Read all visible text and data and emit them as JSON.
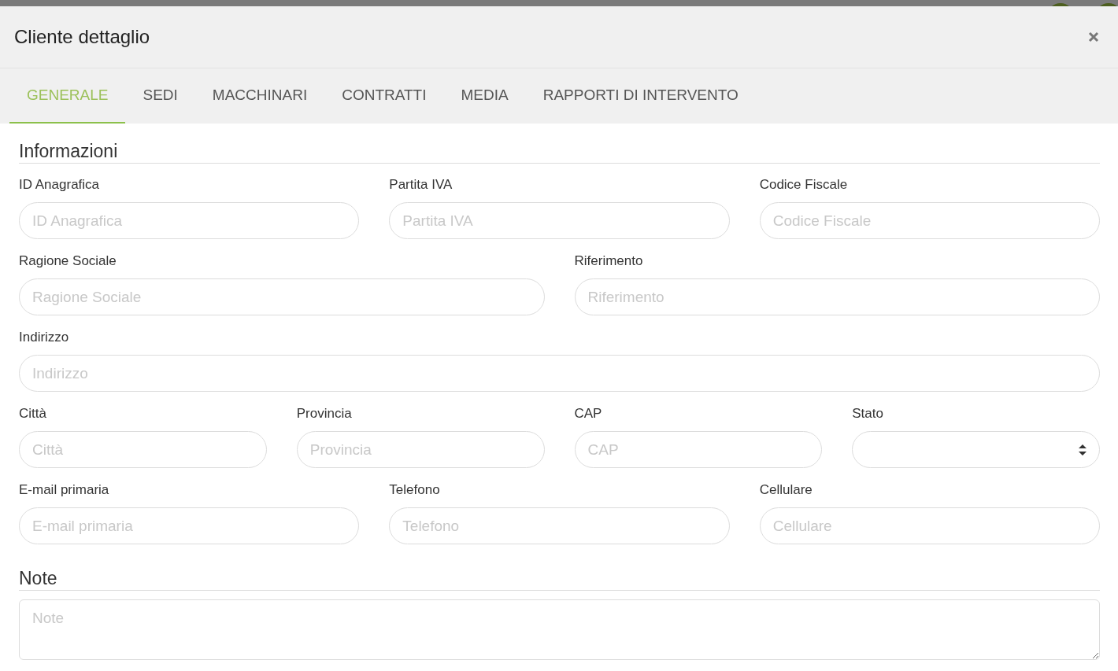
{
  "dialog": {
    "title": "Cliente dettaglio"
  },
  "tabs": [
    {
      "label": "GENERALE",
      "selected": true
    },
    {
      "label": "SEDI",
      "selected": false
    },
    {
      "label": "MACCHINARI",
      "selected": false
    },
    {
      "label": "CONTRATTI",
      "selected": false
    },
    {
      "label": "MEDIA",
      "selected": false
    },
    {
      "label": "RAPPORTI DI INTERVENTO",
      "selected": false
    }
  ],
  "sections": [
    {
      "title": "Informazioni",
      "rows": [
        [
          {
            "kind": "input",
            "label": "ID Anagrafica",
            "placeholder": "ID Anagrafica"
          },
          {
            "kind": "input",
            "label": "Partita IVA",
            "placeholder": "Partita IVA"
          },
          {
            "kind": "input",
            "label": "Codice Fiscale",
            "placeholder": "Codice Fiscale"
          }
        ],
        [
          {
            "kind": "input",
            "label": "Ragione Sociale",
            "placeholder": "Ragione Sociale"
          },
          {
            "kind": "input",
            "label": "Riferimento",
            "placeholder": "Riferimento"
          }
        ],
        [
          {
            "kind": "input",
            "label": "Indirizzo",
            "placeholder": "Indirizzo"
          }
        ],
        [
          {
            "kind": "input",
            "label": "Città",
            "placeholder": "Città"
          },
          {
            "kind": "input",
            "label": "Provincia",
            "placeholder": "Provincia"
          },
          {
            "kind": "input",
            "label": "CAP",
            "placeholder": "CAP"
          },
          {
            "kind": "select",
            "label": "Stato"
          }
        ],
        [
          {
            "kind": "input",
            "label": "E-mail primaria",
            "placeholder": "E-mail primaria"
          },
          {
            "kind": "input",
            "label": "Telefono",
            "placeholder": "Telefono"
          },
          {
            "kind": "input",
            "label": "Cellulare",
            "placeholder": "Cellulare"
          }
        ]
      ]
    },
    {
      "title": "Note",
      "rows": [
        [
          {
            "kind": "textarea",
            "placeholder": "Note"
          }
        ]
      ]
    }
  ]
}
